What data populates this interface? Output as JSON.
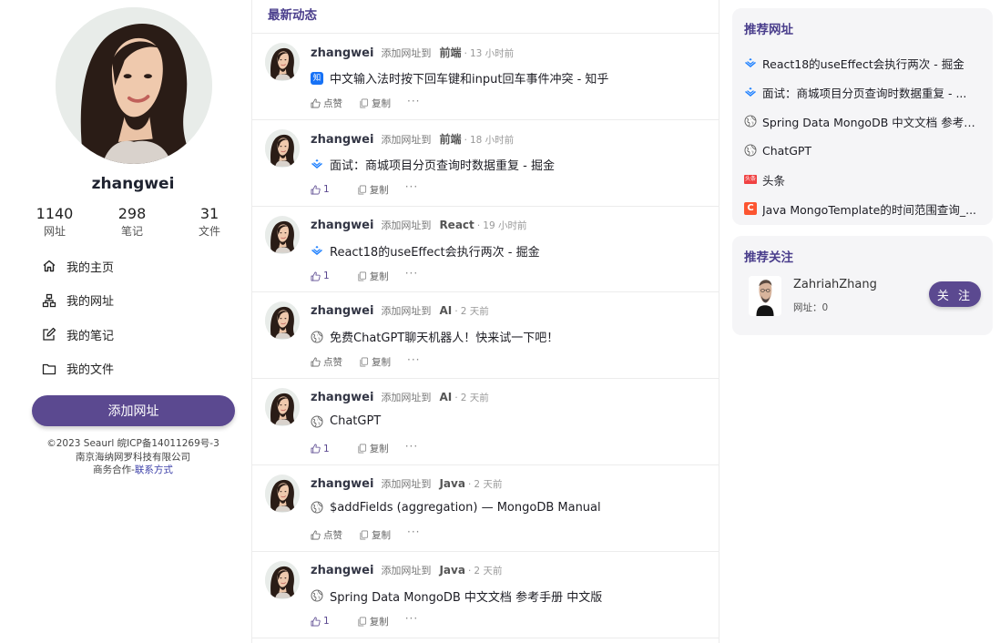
{
  "profile": {
    "username": "zhangwei",
    "stats": [
      {
        "value": "1140",
        "label": "网址"
      },
      {
        "value": "298",
        "label": "笔记"
      },
      {
        "value": "31",
        "label": "文件"
      }
    ],
    "nav": [
      {
        "label": "我的主页",
        "icon": "home-icon"
      },
      {
        "label": "我的网址",
        "icon": "sitemap-icon"
      },
      {
        "label": "我的笔记",
        "icon": "edit-icon"
      },
      {
        "label": "我的文件",
        "icon": "folder-icon"
      }
    ],
    "add_button": "添加网址",
    "footer": {
      "line1": "©2023 Seaurl 皖ICP备14011269号-3",
      "line2": "南京海纳网罗科技有限公司",
      "line3_prefix": "商务合作-",
      "line3_link": "联系方式"
    }
  },
  "feed": {
    "title": "最新动态",
    "items": [
      {
        "user": "zhangwei",
        "action": "添加网址到",
        "category": "前端",
        "dot": "·",
        "time": "13 小时前",
        "icon": "zhihu-icon",
        "title": "中文输入法时按下回车键和input回车事件冲突 - 知乎",
        "like": "点赞",
        "copy": "复制",
        "more": "···"
      },
      {
        "user": "zhangwei",
        "action": "添加网址到",
        "category": "前端",
        "dot": "·",
        "time": "18 小时前",
        "icon": "juejin-icon",
        "title": "面试：商城项目分页查询时数据重复 - 掘金",
        "like": "1",
        "copy": "复制",
        "more": "···"
      },
      {
        "user": "zhangwei",
        "action": "添加网址到",
        "category": "React",
        "dot": "·",
        "time": "19 小时前",
        "icon": "juejin-icon",
        "title": "React18的useEffect会执行两次 - 掘金",
        "like": "1",
        "copy": "复制",
        "more": "···"
      },
      {
        "user": "zhangwei",
        "action": "添加网址到",
        "category": "AI",
        "dot": "·",
        "time": "2 天前",
        "icon": "globe-icon",
        "title": "免费ChatGPT聊天机器人！快来试一下吧！",
        "like": "点赞",
        "copy": "复制",
        "more": "···"
      },
      {
        "user": "zhangwei",
        "action": "添加网址到",
        "category": "AI",
        "dot": "·",
        "time": "2 天前",
        "icon": "globe-icon",
        "title": "ChatGPT",
        "like": "1",
        "copy": "复制",
        "more": "···"
      },
      {
        "user": "zhangwei",
        "action": "添加网址到",
        "category": "Java",
        "dot": "·",
        "time": "2 天前",
        "icon": "globe-icon",
        "title": "$addFields (aggregation) — MongoDB Manual",
        "like": "点赞",
        "copy": "复制",
        "more": "···"
      },
      {
        "user": "zhangwei",
        "action": "添加网址到",
        "category": "Java",
        "dot": "·",
        "time": "2 天前",
        "icon": "globe-icon",
        "title": "Spring Data MongoDB 中文文档 参考手册 中文版",
        "like": "1",
        "copy": "复制",
        "more": "···"
      }
    ]
  },
  "recommend_sites": {
    "title": "推荐网址",
    "items": [
      {
        "icon": "juejin-icon",
        "text": "React18的useEffect会执行两次 - 掘金"
      },
      {
        "icon": "juejin-icon",
        "text": "面试：商城项目分页查询时数据重复 - ..."
      },
      {
        "icon": "globe-icon",
        "text": "Spring Data MongoDB 中文文档 参考手..."
      },
      {
        "icon": "globe-icon",
        "text": "ChatGPT"
      },
      {
        "icon": "toutiao-icon",
        "text": "头条"
      },
      {
        "icon": "csdn-icon",
        "text": "Java MongoTemplate的时间范围查询_..."
      }
    ]
  },
  "recommend_follow": {
    "title": "推荐关注",
    "name": "ZahriahZhang",
    "sub": "网址：0",
    "button": "关 注"
  },
  "icon_text": {
    "zhihu": "知",
    "toutiao": "头条",
    "csdn": "C"
  },
  "colors": {
    "accent": "#5b4990",
    "title": "#4a3e8c",
    "juejin": "#1e80ff",
    "zhihu": "#1772f6",
    "toutiao": "#f04142",
    "csdn": "#fc5531"
  }
}
